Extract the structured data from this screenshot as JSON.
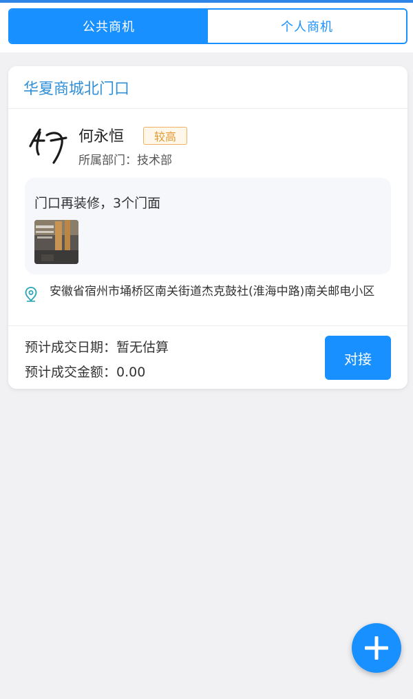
{
  "colors": {
    "accent": "#1890ff",
    "title_blue": "#2f8fd8",
    "badge_orange": "#e19a35",
    "background": "#f1f1f3"
  },
  "tabs": [
    {
      "label": "公共商机",
      "active": true
    },
    {
      "label": "个人商机",
      "active": false
    }
  ],
  "opportunity": {
    "title": "华夏商城北门口",
    "owner": {
      "name": "何永恒",
      "priority_badge": "较高",
      "department": "所属部门：技术部"
    },
    "note": {
      "text": "门口再装修，3个门面"
    },
    "address": {
      "icon": "location-pin-icon",
      "text": "安徽省宿州市埇桥区南关街道杰克鼓社(淮海中路)南关邮电小区"
    },
    "expected_date": "预计成交日期：暂无估算",
    "expected_amount": "预计成交金额：0.00",
    "connect_label": "对接"
  },
  "fab": {
    "icon": "plus-icon"
  }
}
